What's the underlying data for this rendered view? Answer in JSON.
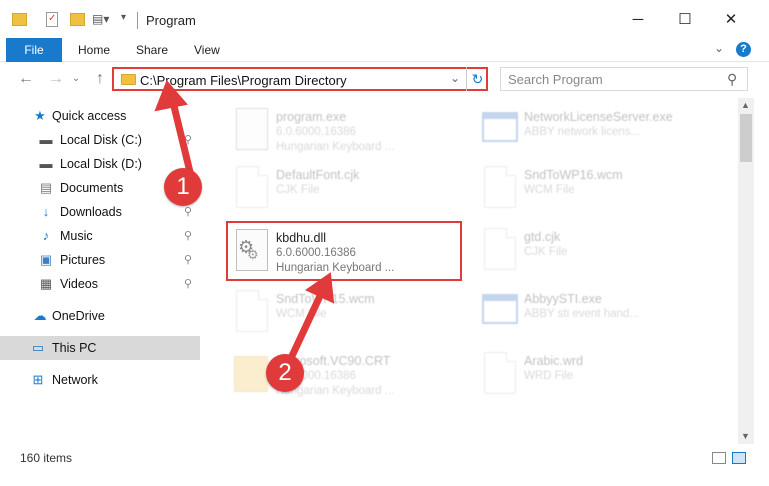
{
  "window": {
    "title": "Program",
    "minimize": "─",
    "maximize": "☐",
    "close": "✕"
  },
  "ribbon": {
    "file": "File",
    "home": "Home",
    "share": "Share",
    "view": "View",
    "help": "?"
  },
  "address": {
    "path": "C:\\Program Files\\Program Directory",
    "refresh": "↻"
  },
  "search": {
    "placeholder": "Search Program"
  },
  "nav": {
    "quick_access": "Quick access",
    "local_c": "Local Disk (C:)",
    "local_d": "Local Disk (D:)",
    "documents": "Documents",
    "downloads": "Downloads",
    "music": "Music",
    "pictures": "Pictures",
    "videos": "Videos",
    "onedrive": "OneDrive",
    "this_pc": "This PC",
    "network": "Network"
  },
  "files": {
    "f1": {
      "name": "program.exe",
      "line2": "6.0.6000.16386",
      "line3": "Hungarian Keyboard ..."
    },
    "f2": {
      "name": "NetworkLicenseServer.exe",
      "line2": "ABBY network licens..."
    },
    "f3": {
      "name": "DefaultFont.cjk",
      "line2": "CJK File"
    },
    "f4": {
      "name": "SndToWP16.wcm",
      "line2": "WCM File"
    },
    "f5": {
      "name": "kbdhu.dll",
      "line2": "6.0.6000.16386",
      "line3": "Hungarian Keyboard ..."
    },
    "f6": {
      "name": "gtd.cjk",
      "line2": "CJK File"
    },
    "f7": {
      "name": "SndToWP15.wcm",
      "line2": "WCM File"
    },
    "f8": {
      "name": "AbbyySTI.exe",
      "line2": "ABBY sti event hand..."
    },
    "f9": {
      "name": "Microsoft.VC90.CRT",
      "line2": "6.0.6000.16386",
      "line3": "Hungarian Keyboard ..."
    },
    "f10": {
      "name": "Arabic.wrd",
      "line2": "WRD File"
    }
  },
  "status": {
    "items": "160 items"
  },
  "callouts": {
    "one": "1",
    "two": "2"
  },
  "colors": {
    "accent": "#1979ca",
    "annotation": "#e03a3a"
  }
}
